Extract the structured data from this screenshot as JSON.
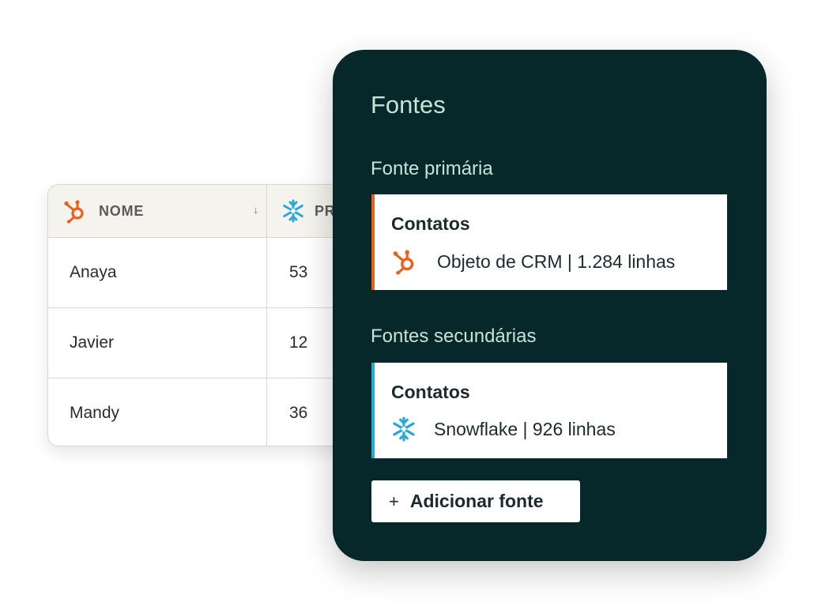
{
  "table": {
    "columns": [
      {
        "label": "NOME",
        "icon": "hubspot-icon",
        "sort_icon": "↓"
      },
      {
        "label": "PR",
        "icon": "snowflake-icon"
      }
    ],
    "rows": [
      {
        "name": "Anaya",
        "value": "53"
      },
      {
        "name": "Javier",
        "value": "12"
      },
      {
        "name": "Mandy",
        "value": "36"
      }
    ]
  },
  "panel": {
    "title": "Fontes",
    "primary": {
      "section_title": "Fonte primária",
      "card": {
        "title": "Contatos",
        "icon": "hubspot-icon",
        "detail": "Objeto de CRM | 1.284 linhas",
        "accent": "#e8611c"
      }
    },
    "secondary": {
      "section_title": "Fontes secundárias",
      "card": {
        "title": "Contatos",
        "icon": "snowflake-icon",
        "detail": "Snowflake | 926 linhas",
        "accent": "#2aa7d9"
      }
    },
    "add_button": {
      "icon": "+",
      "label": "Adicionar fonte"
    }
  },
  "colors": {
    "panel_bg": "#07282a",
    "panel_text": "#c7e3d5",
    "hubspot": "#e8611c",
    "snowflake": "#2aa7d9"
  }
}
